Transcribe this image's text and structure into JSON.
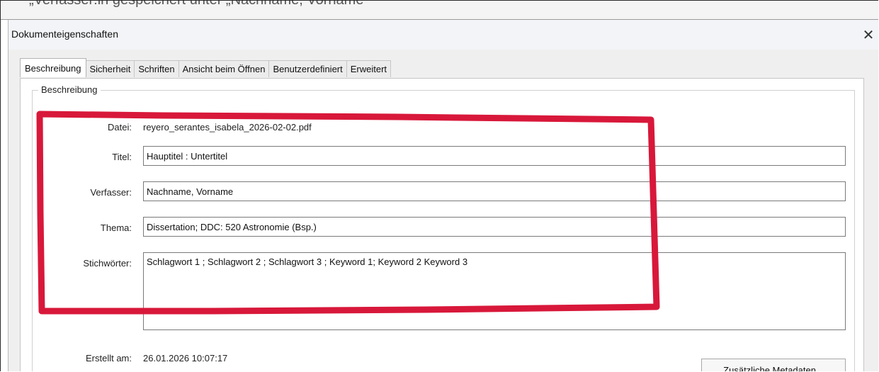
{
  "top_strip_text": "„Verfasser:in gespeichert unter „Nachname, Vorname“",
  "dialog": {
    "title": "Dokumenteigenschaften"
  },
  "tabs": [
    {
      "label": "Beschreibung",
      "active": true
    },
    {
      "label": "Sicherheit",
      "active": false
    },
    {
      "label": "Schriften",
      "active": false
    },
    {
      "label": "Ansicht beim Öffnen",
      "active": false
    },
    {
      "label": "Benutzerdefiniert",
      "active": false
    },
    {
      "label": "Erweitert",
      "active": false
    }
  ],
  "group": {
    "legend": "Beschreibung",
    "file_label": "Datei:",
    "file_value": "reyero_serantes_isabela_2026-02-02.pdf",
    "title_label": "Titel:",
    "title_value": "Hauptitel : Untertitel",
    "author_label": "Verfasser:",
    "author_value": "Nachname, Vorname",
    "subject_label": "Thema:",
    "subject_value": "Dissertation; DDC: 520 Astronomie (Bsp.)",
    "keywords_label": "Stichwörter:",
    "keywords_value": "Schlagwort 1 ; Schlagwort 2 ; Schlagwort 3 ; Keyword 1; Keyword 2 Keyword 3",
    "created_label": "Erstellt am:",
    "created_value": "26.01.2026 10:07:17",
    "metadata_button": "Zusätzliche Metadaten..."
  },
  "colors": {
    "highlight": "#d8183a"
  }
}
